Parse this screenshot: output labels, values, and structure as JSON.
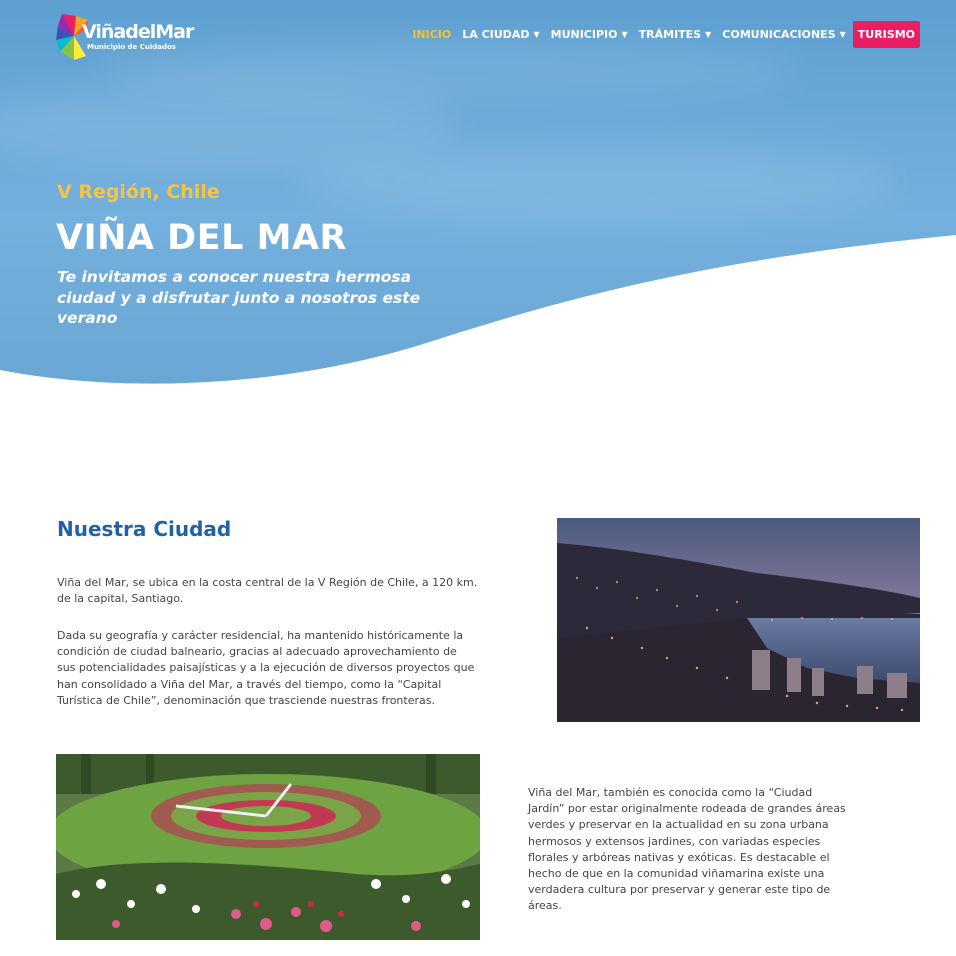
{
  "brand": {
    "logo_text": "ViñadelMar",
    "logo_subtitle": "Municipio de Cuidados"
  },
  "nav": {
    "items": [
      {
        "label": "INICIO",
        "active": true,
        "dropdown": false
      },
      {
        "label": "LA CIUDAD",
        "active": false,
        "dropdown": true
      },
      {
        "label": "MUNICIPIO",
        "active": false,
        "dropdown": true
      },
      {
        "label": "TRÁMITES",
        "active": false,
        "dropdown": true
      },
      {
        "label": "COMUNICACIONES",
        "active": false,
        "dropdown": true
      }
    ],
    "cta_label": "TURISMO"
  },
  "hero": {
    "region": "V Región, Chile",
    "title": "VIÑA DEL MAR",
    "subtitle": "Te invitamos a conocer nuestra hermosa ciudad y a disfrutar junto a nosotros este verano"
  },
  "section": {
    "title": "Nuestra Ciudad",
    "paragraph1": "Viña del Mar, se ubica en la costa central de la V Región de Chile, a 120 km. de la capital, Santiago.",
    "paragraph2": "Dada su geografía y carácter residencial, ha mantenido históricamente la condición de ciudad balneario, gracias al adecuado aprovechamiento de sus potencialidades paisajísticas y a la ejecución de diversos proyectos que han consolidado a Viña del Mar, a través del tiempo, como la “Capital Turística de Chile”, denominación que trasciende nuestras fronteras.",
    "paragraph3": "Viña del Mar, también es conocida como la “Ciudad Jardín” por estar originalmente rodeada de grandes áreas verdes y preservar en la actualidad en su zona urbana hermosos y extensos jardines, con variadas especies florales y arbóreas nativas y exóticas. Es destacable el hecho de que en la comunidad viñamarina existe una verdadera cultura por preservar y generar este tipo de áreas."
  },
  "colors": {
    "accent_yellow": "#f6c445",
    "cta_pink": "#e91e63",
    "heading_blue": "#1f63a6"
  }
}
